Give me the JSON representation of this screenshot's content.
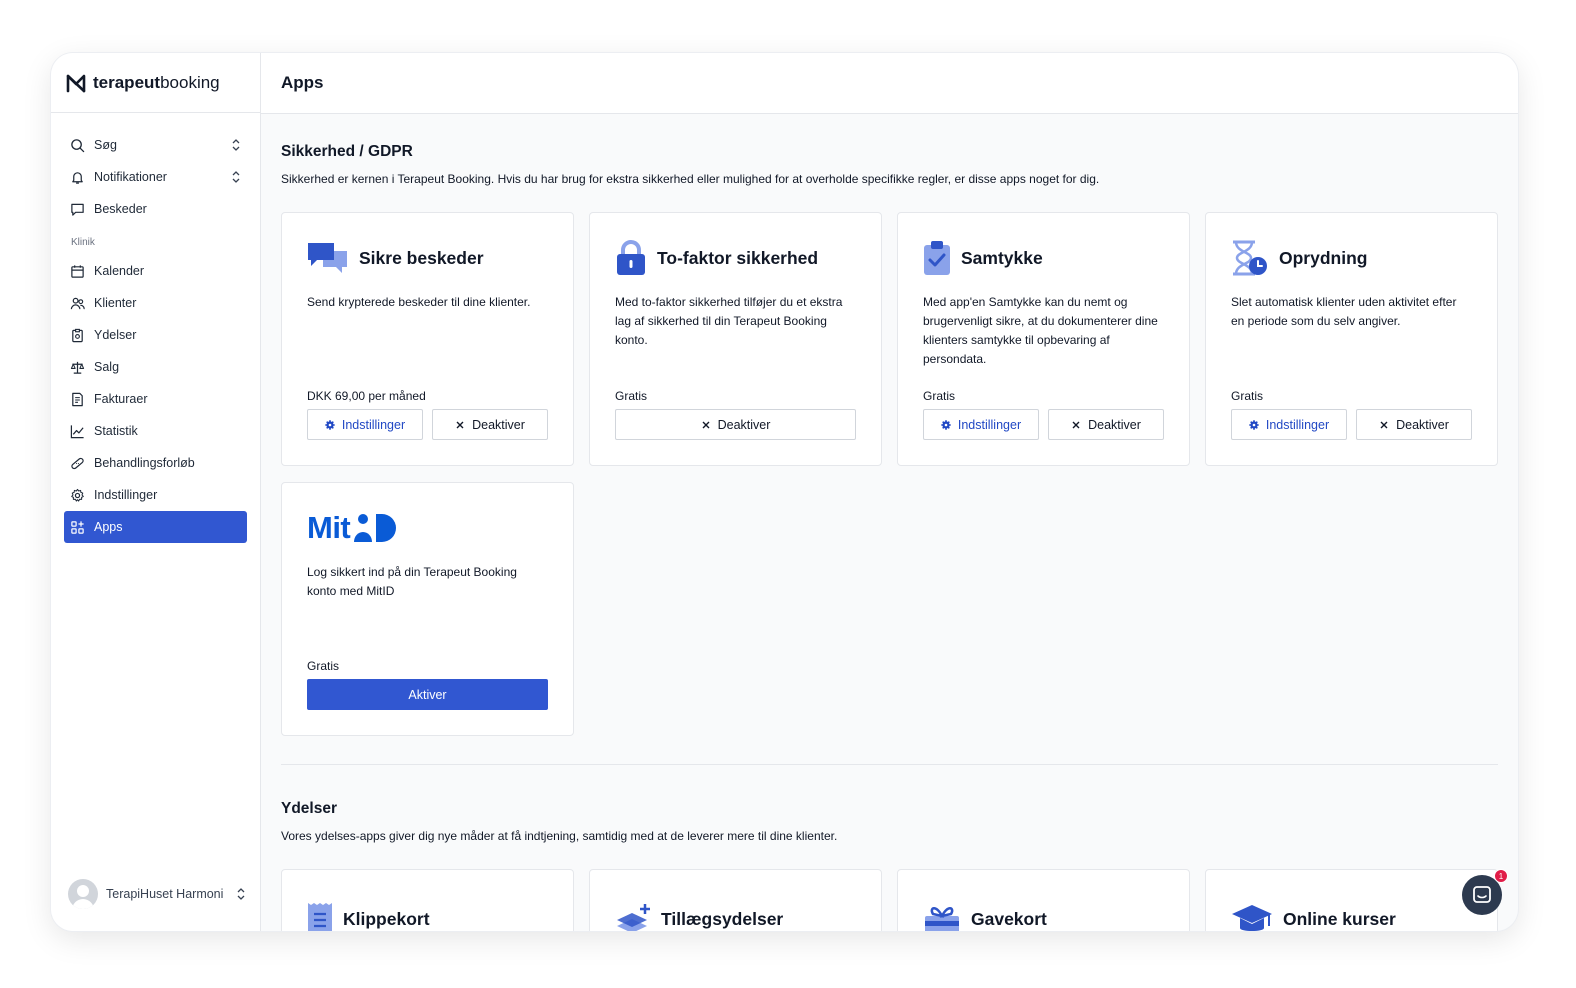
{
  "brand": {
    "name_bold": "terapeut",
    "name_light": "booking"
  },
  "sidebar": {
    "items_top": [
      {
        "label": "Søg",
        "icon": "search-icon"
      },
      {
        "label": "Notifikationer",
        "icon": "bell-icon"
      },
      {
        "label": "Beskeder",
        "icon": "message-icon"
      }
    ],
    "section_label": "Klinik",
    "items_clinic": [
      {
        "label": "Kalender",
        "icon": "calendar-icon"
      },
      {
        "label": "Klienter",
        "icon": "users-icon"
      },
      {
        "label": "Ydelser",
        "icon": "clipboard-icon"
      },
      {
        "label": "Salg",
        "icon": "scale-icon"
      },
      {
        "label": "Fakturaer",
        "icon": "invoice-icon"
      },
      {
        "label": "Statistik",
        "icon": "chart-icon"
      },
      {
        "label": "Behandlingsforløb",
        "icon": "bandage-icon"
      },
      {
        "label": "Indstillinger",
        "icon": "gear-icon"
      },
      {
        "label": "Apps",
        "icon": "apps-icon",
        "active": true
      }
    ],
    "user_name": "TerapiHuset Harmoni"
  },
  "header": {
    "title": "Apps"
  },
  "security": {
    "title": "Sikkerhed / GDPR",
    "description": "Sikkerhed er kernen i Terapeut Booking. Hvis du har brug for ekstra sikkerhed eller mulighed for at overholde specifikke regler, er disse apps noget for dig.",
    "cards": [
      {
        "title": "Sikre beskeder",
        "icon": "chat-bubbles-icon",
        "description": "Send krypterede beskeder til dine klienter.",
        "price": "DKK 69,00 per måned",
        "settings_label": "Indstillinger",
        "deactivate_label": "Deaktiver"
      },
      {
        "title": "To-faktor sikkerhed",
        "icon": "lock-icon",
        "description": "Med to-faktor sikkerhed tilføjer du et ekstra lag af sikkerhed til din Terapeut Booking konto.",
        "price": "Gratis",
        "deactivate_label": "Deaktiver"
      },
      {
        "title": "Samtykke",
        "icon": "clipboard-check-icon",
        "description": "Med app'en Samtykke kan du nemt og brugervenligt sikre, at du dokumenterer dine klienters samtykke til opbevaring af persondata.",
        "price": "Gratis",
        "settings_label": "Indstillinger",
        "deactivate_label": "Deaktiver"
      },
      {
        "title": "Oprydning",
        "icon": "hourglass-icon",
        "description": "Slet automatisk klienter uden aktivitet efter en periode som du selv angiver.",
        "price": "Gratis",
        "settings_label": "Indstillinger",
        "deactivate_label": "Deaktiver"
      },
      {
        "logo_text": "Mit",
        "icon": "mitid-logo",
        "description": "Log sikkert ind på din Terapeut Booking konto med MitID",
        "price": "Gratis",
        "activate_label": "Aktiver"
      }
    ]
  },
  "services": {
    "title": "Ydelser",
    "description": "Vores ydelses-apps giver dig nye måder at få indtjening, samtidig med at de leverer mere til dine klienter.",
    "cards": [
      {
        "title": "Klippekort",
        "icon": "punch-card-icon"
      },
      {
        "title": "Tillægsydelser",
        "icon": "layers-plus-icon"
      },
      {
        "title": "Gavekort",
        "icon": "gift-icon"
      },
      {
        "title": "Online kurser",
        "icon": "graduation-cap-icon"
      }
    ]
  },
  "chat": {
    "badge_count": "1"
  },
  "colors": {
    "accent": "#3157d1",
    "icon_dark": "#2f55c8",
    "icon_light": "#8aa2ea"
  }
}
